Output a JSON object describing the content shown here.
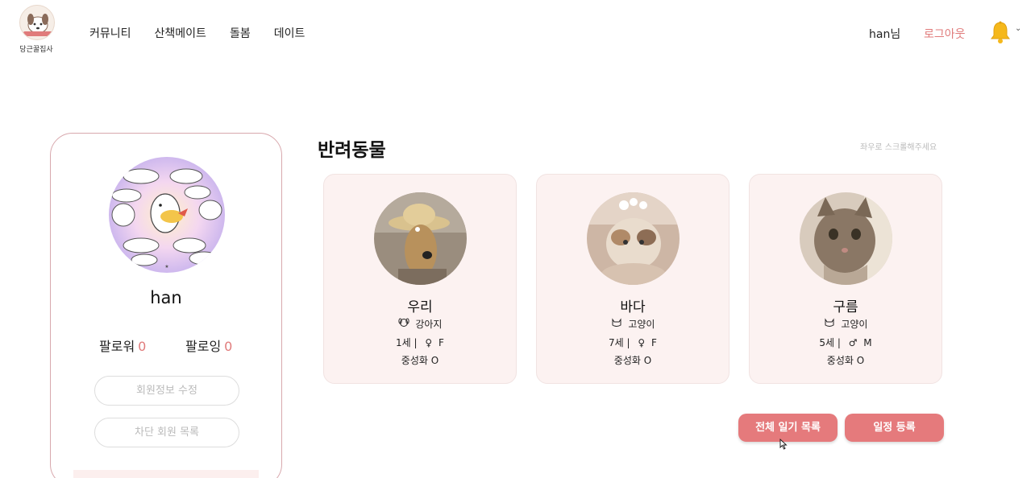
{
  "brand": {
    "logo_text": "당근꿀집사"
  },
  "nav": [
    "커뮤니티",
    "산책메이트",
    "돌봄",
    "데이트"
  ],
  "header": {
    "user_label": "han님",
    "logout_label": "로그아웃",
    "bell_icon": "bell-icon"
  },
  "profile": {
    "name": "han",
    "follower_label": "팔로워",
    "follower_count": "0",
    "following_label": "팔로잉",
    "following_count": "0",
    "edit_button": "회원정보 수정",
    "blocked_button": "차단 회원 목록"
  },
  "pets_section": {
    "title": "반려동물",
    "scroll_hint": "좌우로 스크롤해주세요"
  },
  "pets": [
    {
      "name": "우리",
      "species": "강아지",
      "species_icon": "dog-icon",
      "age": "1세 |",
      "gender_icon": "female-icon",
      "gender": "F",
      "neutered": "중성화 O"
    },
    {
      "name": "바다",
      "species": "고양이",
      "species_icon": "cat-icon",
      "age": "7세 |",
      "gender_icon": "female-icon",
      "gender": "F",
      "neutered": "중성화 O"
    },
    {
      "name": "구름",
      "species": "고양이",
      "species_icon": "cat-icon",
      "age": "5세 |",
      "gender_icon": "male-icon",
      "gender": "M",
      "neutered": "중성화 O"
    }
  ],
  "actions": {
    "diary_button": "전체 일기 목록",
    "schedule_button": "일정 등록"
  },
  "colors": {
    "accent": "#e07b7b",
    "card_bg": "#fcf2f1",
    "button": "#e57a7c"
  }
}
